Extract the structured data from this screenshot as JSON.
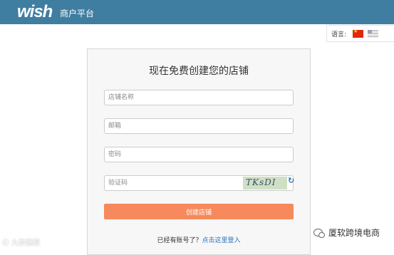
{
  "header": {
    "logo_text": "wish",
    "portal_title": "商户平台"
  },
  "language": {
    "label": "语言:",
    "options": [
      "chinese-flag",
      "us-flag"
    ]
  },
  "form": {
    "title": "现在免费创建您的店铺",
    "store_name_placeholder": "店铺名称",
    "email_placeholder": "邮箱",
    "password_placeholder": "密码",
    "captcha_placeholder": "验证码",
    "captcha_text": "TKsDI",
    "submit_label": "创建店铺",
    "login_prompt": "已经有账号了？",
    "login_link": "点击这里登入"
  },
  "watermarks": {
    "left": "Ⓒ 九数据报",
    "right": "厦软跨境电商"
  },
  "colors": {
    "header_bg": "#3f7ea0",
    "button_bg": "#f68a5c",
    "link": "#2a73b8"
  }
}
